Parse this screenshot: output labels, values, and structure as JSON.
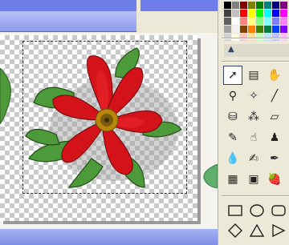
{
  "app": {
    "accent_color": "#6F7FE9",
    "panel_color": "#ECE9D8"
  },
  "canvas": {
    "background": "transparency-checkerboard",
    "image": "red-rose-with-leaves",
    "selection": "dashed-marquee"
  },
  "palette": {
    "colors": [
      "#000000",
      "#808080",
      "#800000",
      "#808000",
      "#008000",
      "#008080",
      "#000080",
      "#800080",
      "#404040",
      "#C0C0C0",
      "#FF0000",
      "#FFFF00",
      "#00FF00",
      "#00FFFF",
      "#0000FF",
      "#FF00FF",
      "#606060",
      "#FFFFFF",
      "#FF8080",
      "#FFFF80",
      "#80FF80",
      "#80FFFF",
      "#8080FF",
      "#FF80FF",
      "#A0A0A0",
      "#F0F0F0",
      "#804000",
      "#FF8000",
      "#408000",
      "#008040",
      "#0040FF",
      "#8000FF",
      "#D0D0D0",
      "#FFFFE0",
      "#FFC0C0",
      "#FFE0A0",
      "#C0FFC0",
      "#C0E0FF",
      "#C0C0FF",
      "#FFC0FF"
    ]
  },
  "tools": [
    {
      "name": "arrow-select-tool",
      "glyph": "➚",
      "active": true
    },
    {
      "name": "layer-select-tool",
      "glyph": "▤"
    },
    {
      "name": "hand-pan-tool",
      "glyph": "✋"
    },
    {
      "name": "eyedropper-tool",
      "glyph": "⚲"
    },
    {
      "name": "magic-wand-tool",
      "glyph": "✧"
    },
    {
      "name": "line-tool",
      "glyph": "╱"
    },
    {
      "name": "paint-bucket-tool",
      "glyph": "⛁"
    },
    {
      "name": "spray-tool",
      "glyph": "⁂"
    },
    {
      "name": "eraser-tool",
      "glyph": "▱"
    },
    {
      "name": "brush-tool",
      "glyph": "✎"
    },
    {
      "name": "smudge-tool",
      "glyph": "☝"
    },
    {
      "name": "stamp-tool",
      "glyph": "♟"
    },
    {
      "name": "droplet-tool",
      "glyph": "💧"
    },
    {
      "name": "sharpen-tool",
      "glyph": "✍"
    },
    {
      "name": "pen-tool",
      "glyph": "✒"
    },
    {
      "name": "mesh-tool",
      "glyph": "▦"
    },
    {
      "name": "picture-tube-tool",
      "glyph": "▣"
    },
    {
      "name": "strawberry-tube-tool",
      "glyph": "🍓"
    }
  ],
  "shapes": [
    {
      "name": "rectangle-shape-icon"
    },
    {
      "name": "ellipse-shape-icon"
    },
    {
      "name": "rounded-rectangle-shape-icon"
    },
    {
      "name": "diamond-shape-icon"
    },
    {
      "name": "triangle-shape-icon"
    },
    {
      "name": "right-triangle-shape-icon"
    }
  ]
}
